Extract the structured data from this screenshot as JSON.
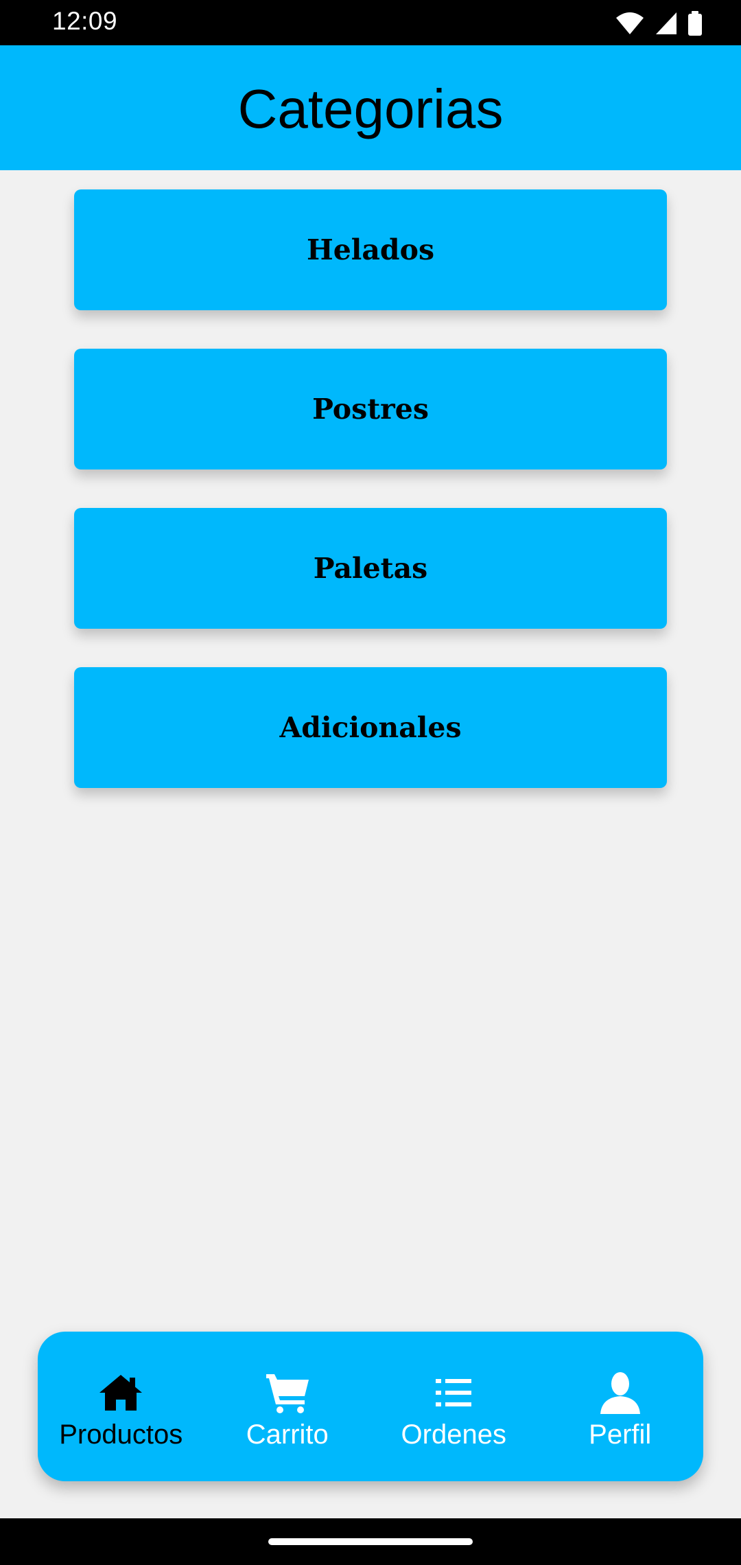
{
  "status_bar": {
    "time": "12:09"
  },
  "app_bar": {
    "title": "Categorias"
  },
  "categories": [
    {
      "label": "Helados"
    },
    {
      "label": "Postres"
    },
    {
      "label": "Paletas"
    },
    {
      "label": "Adicionales"
    }
  ],
  "bottom_nav": {
    "items": [
      {
        "label": "Productos",
        "icon": "home-icon",
        "active": true
      },
      {
        "label": "Carrito",
        "icon": "cart-icon",
        "active": false
      },
      {
        "label": "Ordenes",
        "icon": "list-icon",
        "active": false
      },
      {
        "label": "Perfil",
        "icon": "person-icon",
        "active": false
      }
    ]
  },
  "colors": {
    "primary": "#00b8fc",
    "background": "#f1f1f1",
    "active_text": "#000000",
    "inactive_text": "#ffffff"
  }
}
